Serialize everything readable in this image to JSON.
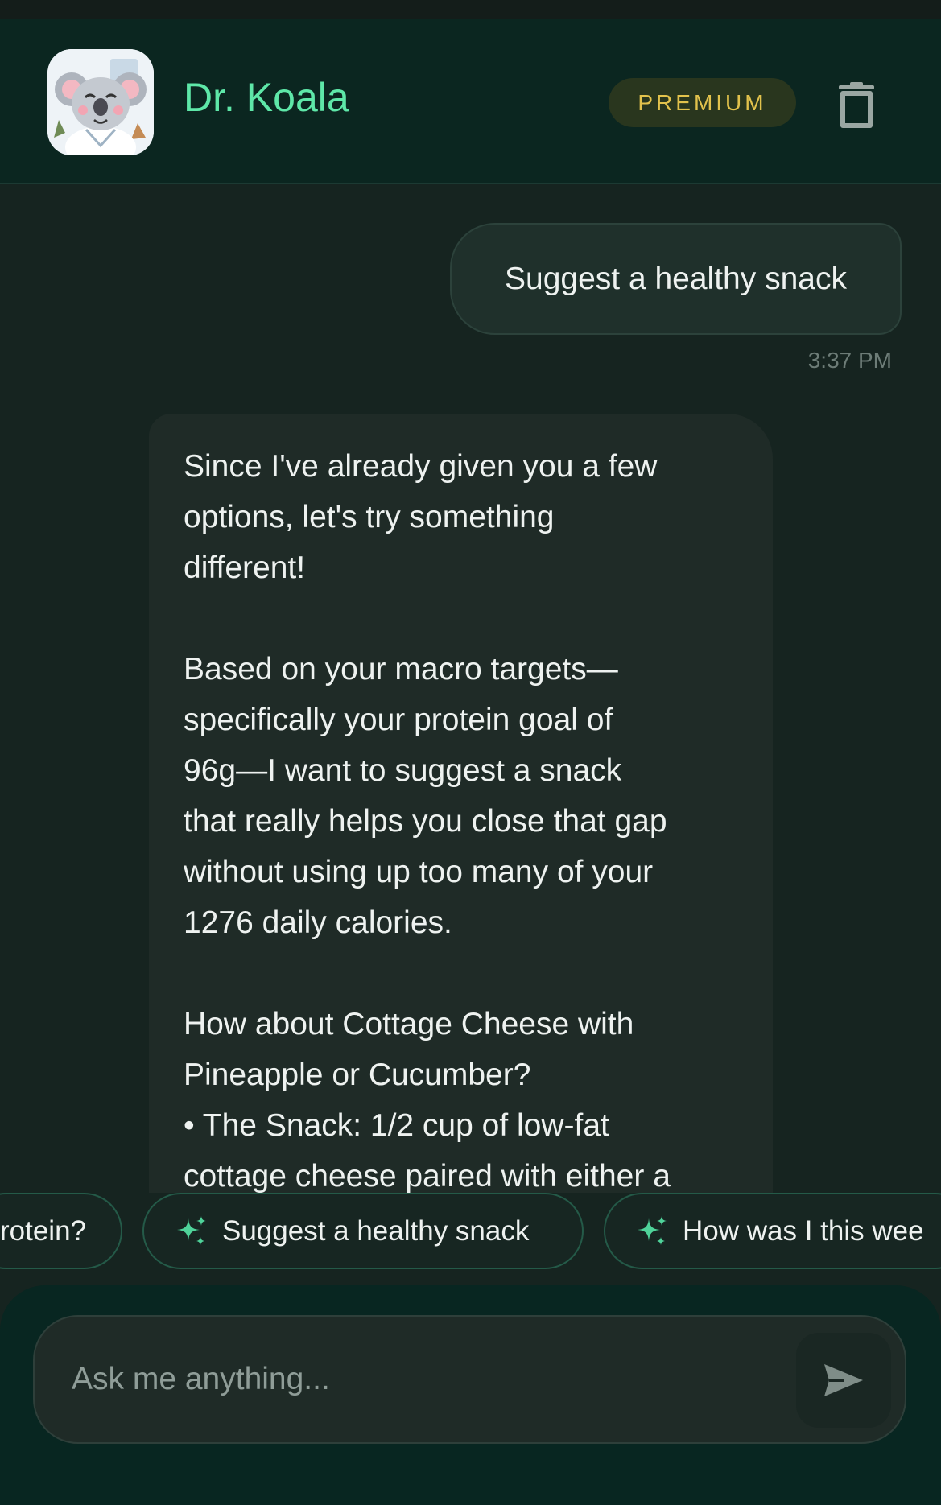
{
  "header": {
    "title": "Dr. Koala",
    "badge": "PREMIUM",
    "avatar_icon": "koala-doctor-avatar",
    "action_icon": "trash-icon"
  },
  "conversation": {
    "user_message": "Suggest a healthy snack",
    "timestamp": "3:37 PM",
    "assistant_paragraphs": [
      "Since I've already given you a few\noptions, let's try something\ndifferent!",
      "Based on your macro targets—\nspecifically your protein goal of\n96g—I want to suggest a snack\nthat really helps you close that gap\nwithout using up too many of your\n1276 daily calories.",
      "How about Cottage Cheese with\nPineapple or Cucumber?\n• The Snack: 1/2 cup of low-fat\ncottage cheese paired with either a"
    ]
  },
  "suggestions": [
    "rotein?",
    "Suggest a healthy snack",
    "How was I this wee"
  ],
  "composer": {
    "placeholder": "Ask me anything...",
    "send_icon": "send-icon"
  },
  "colors": {
    "accent": "#5ee7a8",
    "badge_text": "#e2c24c",
    "header_bg": "#0b2620",
    "page_bg": "#162420"
  }
}
